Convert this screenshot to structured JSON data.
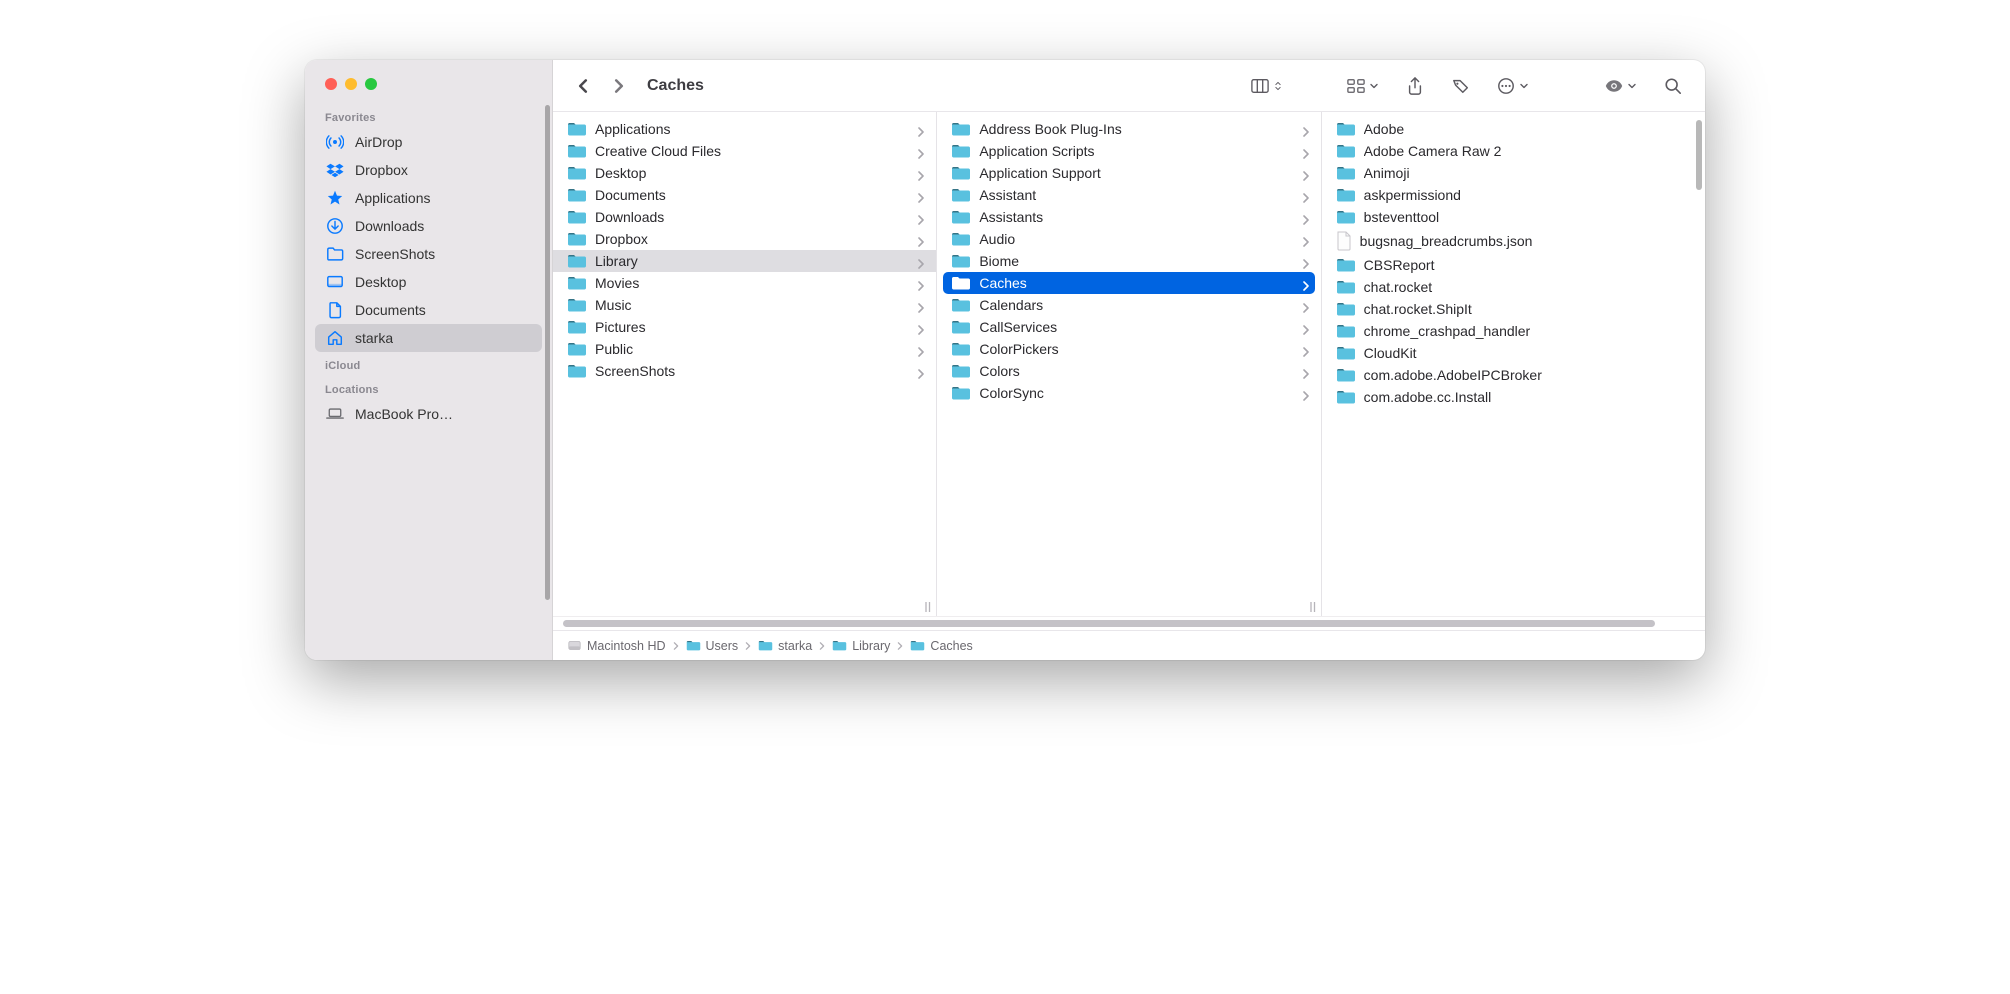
{
  "window": {
    "title": "Caches"
  },
  "sidebar": {
    "sections": [
      {
        "header": "Favorites",
        "items": [
          {
            "label": "AirDrop",
            "icon": "airdrop"
          },
          {
            "label": "Dropbox",
            "icon": "dropbox"
          },
          {
            "label": "Applications",
            "icon": "applications"
          },
          {
            "label": "Downloads",
            "icon": "downloads"
          },
          {
            "label": "ScreenShots",
            "icon": "folder"
          },
          {
            "label": "Desktop",
            "icon": "desktop"
          },
          {
            "label": "Documents",
            "icon": "documents"
          },
          {
            "label": "starka",
            "icon": "home",
            "selected": true
          }
        ]
      },
      {
        "header": "iCloud",
        "items": []
      },
      {
        "header": "Locations",
        "items": [
          {
            "label": "MacBook Pro…",
            "icon": "laptop",
            "gray": true
          }
        ]
      }
    ]
  },
  "columns": [
    {
      "items": [
        {
          "name": "Applications",
          "type": "folder",
          "hasChildren": true
        },
        {
          "name": "Creative Cloud Files",
          "type": "folder",
          "hasChildren": true
        },
        {
          "name": "Desktop",
          "type": "folder",
          "hasChildren": true
        },
        {
          "name": "Documents",
          "type": "folder",
          "hasChildren": true
        },
        {
          "name": "Downloads",
          "type": "folder",
          "hasChildren": true
        },
        {
          "name": "Dropbox",
          "type": "folder",
          "hasChildren": true
        },
        {
          "name": "Library",
          "type": "folder",
          "hasChildren": true,
          "selected": "gray"
        },
        {
          "name": "Movies",
          "type": "folder",
          "hasChildren": true
        },
        {
          "name": "Music",
          "type": "folder",
          "hasChildren": true
        },
        {
          "name": "Pictures",
          "type": "folder",
          "hasChildren": true
        },
        {
          "name": "Public",
          "type": "folder",
          "hasChildren": true
        },
        {
          "name": "ScreenShots",
          "type": "folder",
          "hasChildren": true
        }
      ]
    },
    {
      "items": [
        {
          "name": "Address Book Plug-Ins",
          "type": "folder",
          "hasChildren": true
        },
        {
          "name": "Application Scripts",
          "type": "folder",
          "hasChildren": true
        },
        {
          "name": "Application Support",
          "type": "folder",
          "hasChildren": true
        },
        {
          "name": "Assistant",
          "type": "folder",
          "hasChildren": true
        },
        {
          "name": "Assistants",
          "type": "folder",
          "hasChildren": true
        },
        {
          "name": "Audio",
          "type": "folder",
          "hasChildren": true
        },
        {
          "name": "Biome",
          "type": "folder",
          "hasChildren": true
        },
        {
          "name": "Caches",
          "type": "folder",
          "hasChildren": true,
          "selected": "blue"
        },
        {
          "name": "Calendars",
          "type": "folder",
          "hasChildren": true
        },
        {
          "name": "CallServices",
          "type": "folder",
          "hasChildren": true
        },
        {
          "name": "ColorPickers",
          "type": "folder",
          "hasChildren": true
        },
        {
          "name": "Colors",
          "type": "folder",
          "hasChildren": true
        },
        {
          "name": "ColorSync",
          "type": "folder",
          "hasChildren": true
        }
      ]
    },
    {
      "items": [
        {
          "name": "Adobe",
          "type": "folder"
        },
        {
          "name": "Adobe Camera Raw 2",
          "type": "folder"
        },
        {
          "name": "Animoji",
          "type": "folder"
        },
        {
          "name": "askpermissiond",
          "type": "folder"
        },
        {
          "name": "bsteventtool",
          "type": "folder"
        },
        {
          "name": "bugsnag_breadcrumbs.json",
          "type": "file"
        },
        {
          "name": "CBSReport",
          "type": "folder"
        },
        {
          "name": "chat.rocket",
          "type": "folder"
        },
        {
          "name": "chat.rocket.ShipIt",
          "type": "folder"
        },
        {
          "name": "chrome_crashpad_handler",
          "type": "folder"
        },
        {
          "name": "CloudKit",
          "type": "folder"
        },
        {
          "name": "com.adobe.AdobeIPCBroker",
          "type": "folder"
        },
        {
          "name": "com.adobe.cc.Install",
          "type": "folder"
        }
      ]
    }
  ],
  "pathbar": [
    {
      "label": "Macintosh HD",
      "icon": "disk"
    },
    {
      "label": "Users",
      "icon": "folder"
    },
    {
      "label": "starka",
      "icon": "folder"
    },
    {
      "label": "Library",
      "icon": "folder"
    },
    {
      "label": "Caches",
      "icon": "folder"
    }
  ]
}
